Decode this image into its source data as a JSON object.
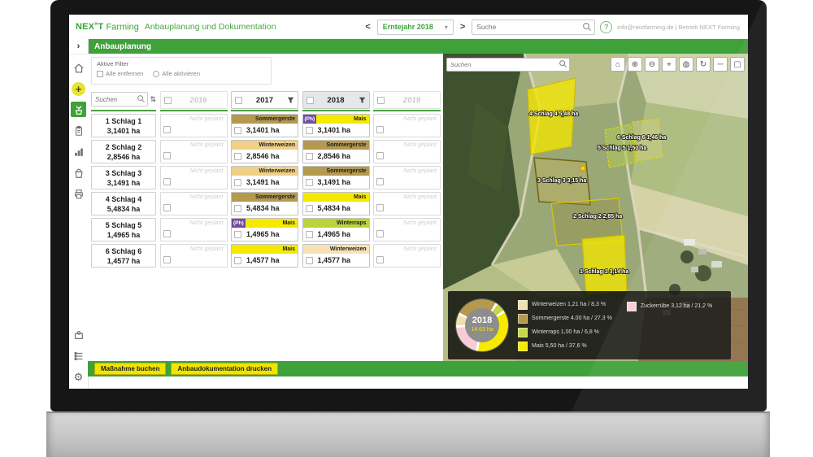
{
  "header": {
    "logo_nex": "NEX",
    "logo_sup": "×",
    "logo_t": "T",
    "logo_word": "Farming",
    "app_title": "Anbauplanung und Dokumentation",
    "prev_glyph": "<",
    "next_glyph": ">",
    "year_select": "Erntejahr 2018",
    "year_dd_glyph": "▾",
    "search_placeholder": "Suche",
    "help_glyph": "?",
    "account": "info@nextfarming.de | Betrieb NEXT Farming"
  },
  "section": {
    "title": "Anbauplanung",
    "expand_glyph": "›"
  },
  "sidebar": {
    "items": [
      "home",
      "add",
      "crop-planning",
      "tasks",
      "statistics",
      "harvest",
      "print"
    ],
    "bottom_items": [
      "modules",
      "list",
      "settings"
    ],
    "settings_glyph": "⚙"
  },
  "filters": {
    "title": "Aktive Filter",
    "action1": "Alle entfernen",
    "action2": "Alle aktivieren"
  },
  "table": {
    "search_placeholder": "Suchen",
    "sort_glyph": "⇅",
    "not_planned": "Nicht geplant",
    "years": [
      {
        "label": "2016"
      },
      {
        "label": "2017"
      },
      {
        "label": "2018"
      },
      {
        "label": "2019"
      }
    ],
    "rows": [
      {
        "name": "1 Schlag 1",
        "area": "3,1401 ha",
        "cells": [
          {
            "type": "empty"
          },
          {
            "type": "crop",
            "crop": "Sommergerste",
            "color": "#b5994e",
            "area": "3,1401 ha"
          },
          {
            "type": "crop",
            "crop": "Mais",
            "color": "#f6e900",
            "tag": "(Ph)",
            "area": "3,1401 ha"
          },
          {
            "type": "empty"
          }
        ]
      },
      {
        "name": "2 Schlag 2",
        "area": "2,8546 ha",
        "cells": [
          {
            "type": "empty"
          },
          {
            "type": "crop",
            "crop": "Winterweizen",
            "color": "#f0d084",
            "area": "2,8546 ha"
          },
          {
            "type": "crop",
            "crop": "Sommergerste",
            "color": "#b5994e",
            "area": "2,8546 ha"
          },
          {
            "type": "empty"
          }
        ]
      },
      {
        "name": "3 Schlag 3",
        "area": "3,1491 ha",
        "cells": [
          {
            "type": "empty"
          },
          {
            "type": "crop",
            "crop": "Winterweizen",
            "color": "#f0d084",
            "area": "3,1491 ha"
          },
          {
            "type": "crop",
            "crop": "Sommergerste",
            "color": "#b5994e",
            "area": "3,1491 ha"
          },
          {
            "type": "empty"
          }
        ]
      },
      {
        "name": "4 Schlag 4",
        "area": "5,4834 ha",
        "cells": [
          {
            "type": "empty"
          },
          {
            "type": "crop",
            "crop": "Sommergerste",
            "color": "#b5994e",
            "area": "5,4834 ha"
          },
          {
            "type": "crop",
            "crop": "Mais",
            "color": "#f6e900",
            "area": "5,4834 ha"
          },
          {
            "type": "empty"
          }
        ]
      },
      {
        "name": "5 Schlag 5",
        "area": "1,4965 ha",
        "cells": [
          {
            "type": "empty"
          },
          {
            "type": "crop",
            "crop": "Mais",
            "color": "#f6e900",
            "tag": "(Ph)",
            "area": "1,4965 ha"
          },
          {
            "type": "crop",
            "crop": "Winterraps",
            "color": "#bed23a",
            "area": "1,4965 ha"
          },
          {
            "type": "empty"
          }
        ]
      },
      {
        "name": "6 Schlag 6",
        "area": "1,4577 ha",
        "cells": [
          {
            "type": "empty"
          },
          {
            "type": "crop",
            "crop": "Mais",
            "color": "#f6e900",
            "area": "1,4577 ha"
          },
          {
            "type": "crop",
            "crop": "Winterweizen",
            "color": "#f6e2b4",
            "area": "1,4577 ha"
          },
          {
            "type": "empty"
          }
        ]
      }
    ]
  },
  "footer": {
    "button1": "Maßnahme buchen",
    "button2": "Anbaudokumentation drucken"
  },
  "map": {
    "search_placeholder": "Suchen",
    "tools": [
      {
        "name": "home",
        "glyph": "⌂"
      },
      {
        "name": "zoom-in",
        "glyph": "⊕"
      },
      {
        "name": "zoom-out",
        "glyph": "⊖"
      },
      {
        "name": "center",
        "glyph": "⌖"
      },
      {
        "name": "layers",
        "glyph": "◍"
      },
      {
        "name": "refresh",
        "glyph": "↻"
      },
      {
        "name": "measure",
        "glyph": "─"
      },
      {
        "name": "select-area",
        "glyph": "▢"
      }
    ],
    "fields": [
      {
        "label": "4 Schlag 4 5,48 ha"
      },
      {
        "label": "6 Schlag 6 1,46 ha"
      },
      {
        "label": "5 Schlag 5 1,50 ha"
      },
      {
        "label": "3 Schlag 3 3,15 ha"
      },
      {
        "label": "2 Schlag 2 2,85 ha"
      },
      {
        "label": "1 Schlag 1 3,14 ha"
      }
    ],
    "legend": {
      "year": "2018",
      "total": "14.63 ha",
      "items": [
        {
          "label": "Winterweizen 1,21 ha / 8,3 %",
          "color": "#ece2b0",
          "pct": 8.3
        },
        {
          "label": "Sommergerste 4,00 ha / 27,3 %",
          "color": "#b5994e",
          "pct": 27.3
        },
        {
          "label": "Winterraps 1,00 ha / 6,8 %",
          "color": "#c6d64b",
          "pct": 6.8
        },
        {
          "label": "Mais 5,50 ha / 37,6 %",
          "color": "#f5ea00",
          "pct": 37.6
        },
        {
          "label": "Zuckerrübe 3,12 ha / 21,2 %",
          "color": "#f6cdd6",
          "pct": 21.2
        }
      ]
    }
  }
}
